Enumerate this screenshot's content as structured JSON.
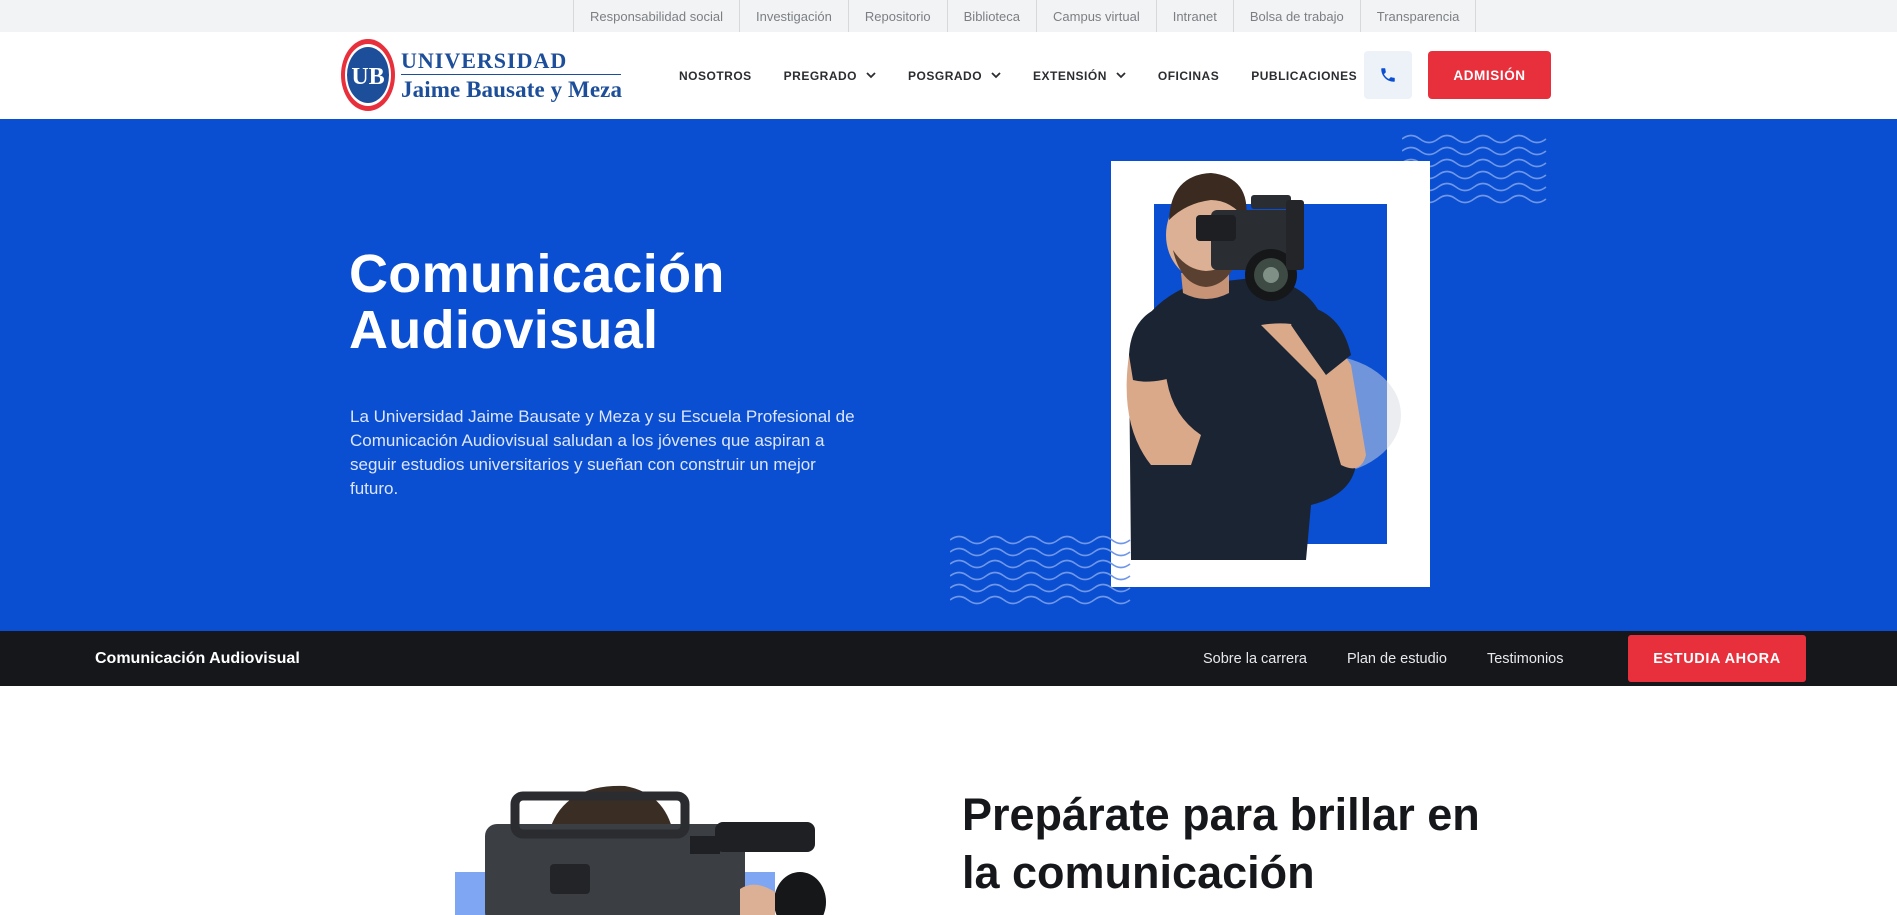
{
  "topbar": {
    "links": [
      "Responsabilidad social",
      "Investigación",
      "Repositorio",
      "Biblioteca",
      "Campus virtual",
      "Intranet",
      "Bolsa de trabajo",
      "Transparencia"
    ]
  },
  "header": {
    "logo": {
      "monogram": "UB",
      "line1": "UNIVERSIDAD",
      "line2": "Jaime Bausate y Meza"
    },
    "nav": [
      {
        "label": "NOSOTROS",
        "dropdown": false
      },
      {
        "label": "PREGRADO",
        "dropdown": true
      },
      {
        "label": "POSGRADO",
        "dropdown": true
      },
      {
        "label": "EXTENSIÓN",
        "dropdown": true
      },
      {
        "label": "OFICINAS",
        "dropdown": false
      },
      {
        "label": "PUBLICACIONES",
        "dropdown": true
      }
    ],
    "phone_icon": "phone-icon",
    "admision_label": "ADMISIÓN"
  },
  "hero": {
    "title": "Comunicación Audiovisual",
    "description": "La Universidad Jaime Bausate y Meza y su Escuela Profesional de Comunicación Audiovisual saludan a los jóvenes que aspiran a seguir estudios universitarios y sueñan con construir un mejor futuro."
  },
  "subnav": {
    "title": "Comunicación Audiovisual",
    "links": [
      "Sobre la carrera",
      "Plan de estudio",
      "Testimonios"
    ],
    "cta": "ESTUDIA AHORA"
  },
  "section": {
    "heading": "Prepárate para brillar en la comunicación"
  },
  "colors": {
    "brand_blue": "#0a4ed2",
    "accent_red": "#e8303d",
    "dark": "#15171b",
    "logo_blue": "#1d4e9a"
  }
}
